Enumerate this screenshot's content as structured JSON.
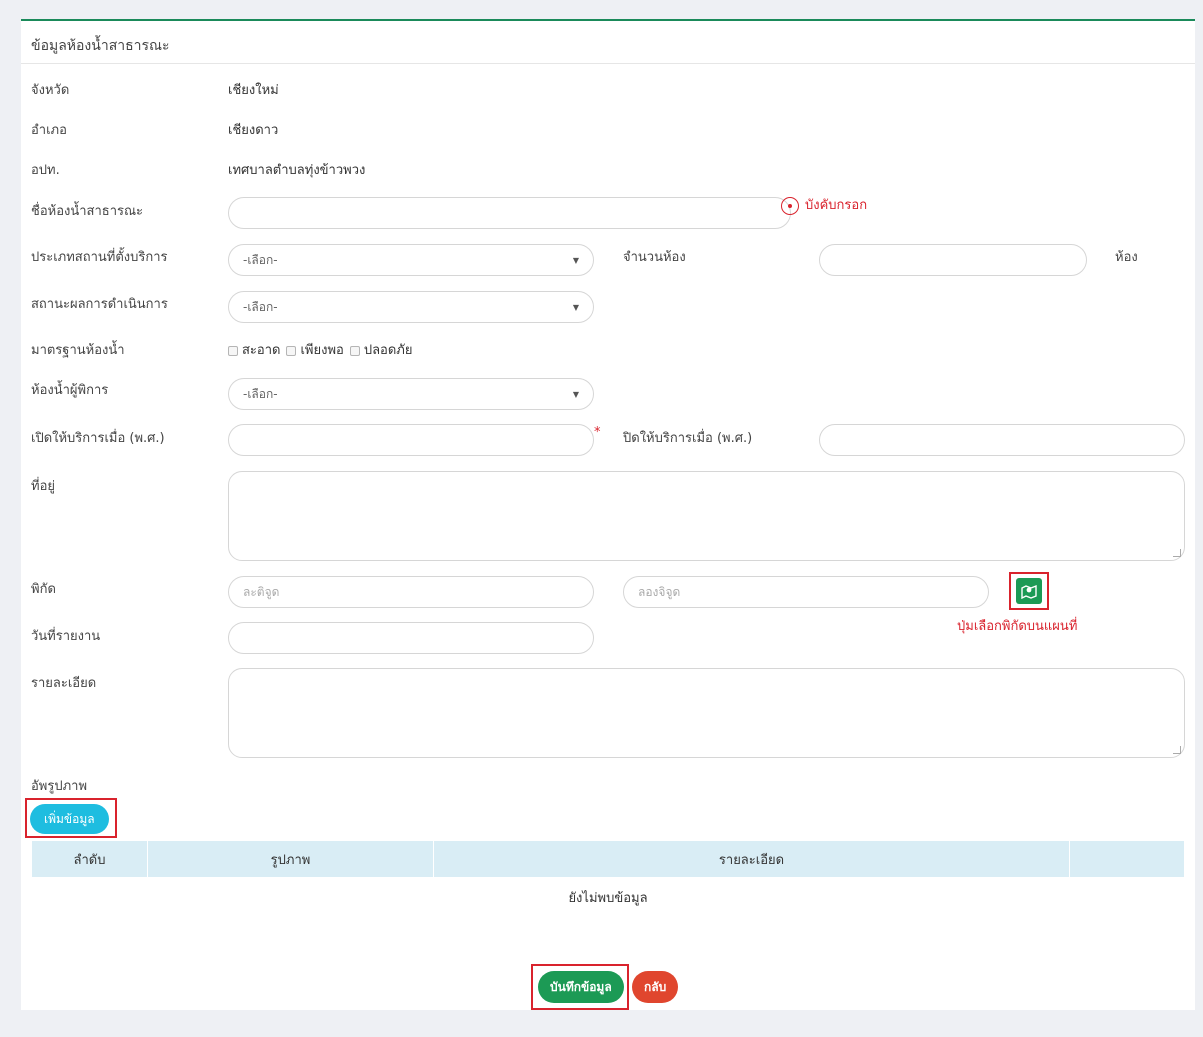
{
  "panel": {
    "title": "ข้อมูลห้องน้ำสาธารณะ"
  },
  "info": {
    "province_label": "จังหวัด",
    "province_value": "เชียงใหม่",
    "district_label": "อำเภอ",
    "district_value": "เชียงดาว",
    "lao_label": "อปท.",
    "lao_value": "เทศบาลตำบลทุ่งข้าวพวง"
  },
  "form": {
    "name_label": "ชื่อห้องน้ำสาธารณะ",
    "required_note": "บังคับกรอก",
    "service_type_label": "ประเภทสถานที่ตั้งบริการ",
    "service_type_value": "-เลือก-",
    "room_count_label": "จำนวนห้อง",
    "room_unit": "ห้อง",
    "status_label": "สถานะผลการดำเนินการ",
    "status_value": "-เลือก-",
    "standard_label": "มาตรฐานห้องน้ำ",
    "standard_options": [
      "สะอาด",
      "เพียงพอ",
      "ปลอดภัย"
    ],
    "disabled_label": "ห้องน้ำผู้พิการ",
    "disabled_value": "-เลือก-",
    "open_label": "เปิดให้บริการเมื่อ (พ.ศ.)",
    "required_star": "*",
    "close_label": "ปิดให้บริการเมื่อ (พ.ศ.)",
    "address_label": "ที่อยู่",
    "coords_label": "พิกัด",
    "lat_placeholder": "ละติจูด",
    "lng_placeholder": "ลองจิจูด",
    "map_note": "ปุ่มเลือกพิกัดบนแผนที่",
    "report_date_label": "วันที่รายงาน",
    "detail_label": "รายละเอียด",
    "upload_label": "อัพรูปภาพ",
    "add_button": "เพิ่มข้อมูล"
  },
  "table": {
    "columns": [
      "ลำดับ",
      "รูปภาพ",
      "รายละเอียด"
    ],
    "empty_text": "ยังไม่พบข้อมูล"
  },
  "actions": {
    "save": "บันทึกข้อมูล",
    "back": "กลับ"
  },
  "colors": {
    "accent": "#1a8a5a",
    "annotation": "#d9232d",
    "add_button": "#1ebde0",
    "back_button": "#e0462e",
    "table_header": "#d9edf5"
  }
}
